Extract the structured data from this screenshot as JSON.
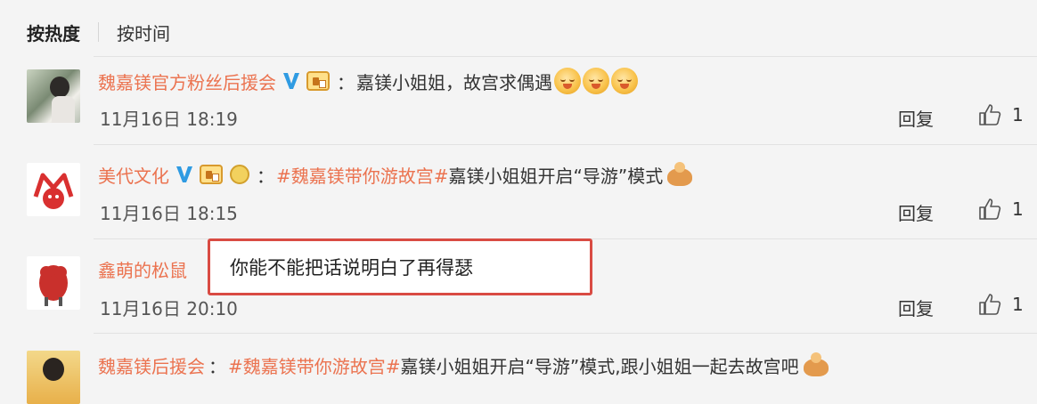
{
  "tabs": {
    "hot": "按热度",
    "time": "按时间"
  },
  "comments": [
    {
      "user": "魏嘉镁官方粉丝后援会",
      "text": "嘉镁小姐姐，故宫求偶遇",
      "topic": "",
      "time": "11月16日 18:19",
      "reply": "回复",
      "likes": "1"
    },
    {
      "user": "美代文化",
      "topic": "#魏嘉镁带你游故宫#",
      "text": " 嘉镁小姐姐开启“导游”模式",
      "time": "11月16日 18:15",
      "reply": "回复",
      "likes": "1"
    },
    {
      "user": "鑫萌的松鼠",
      "text": "你能不能把话说明白了再得瑟",
      "topic": "",
      "time": "11月16日 20:10",
      "reply": "回复",
      "likes": "1"
    },
    {
      "user": "魏嘉镁后援会",
      "topic": "#魏嘉镁带你游故宫#",
      "text": " 嘉镁小姐姐开启“导游”模式,跟小姐姐一起去故宫吧",
      "time": "",
      "reply": "",
      "likes": ""
    }
  ],
  "colon": "：",
  "colors": {
    "username": "#eb7350",
    "highlight_border": "#d94b43",
    "verified": "#2f9be2"
  },
  "icons": [
    "verified-v-icon",
    "fan-badge-icon",
    "smiley-emoji-icon",
    "turkey-emoji-icon",
    "thumbs-up-icon"
  ]
}
